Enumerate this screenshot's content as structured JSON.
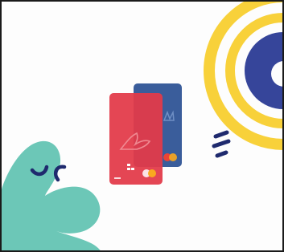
{
  "illustration": {
    "palette": {
      "background": "#fdfdfd",
      "frame": "#1a1a1a",
      "ring_yellow": "#f8d13a",
      "circle_navy": "#36459a",
      "leaf_teal": "#6cc7b7",
      "mark_navy": "#1f2a6e",
      "card_red": "#e23a49",
      "card_blue": "#3a5d9b",
      "mastercard_red": "#ea4336",
      "mastercard_yellow": "#f9a91f"
    },
    "icons": [
      "bird-logo-icon",
      "chip-icon",
      "mastercard-logo-icon"
    ]
  }
}
